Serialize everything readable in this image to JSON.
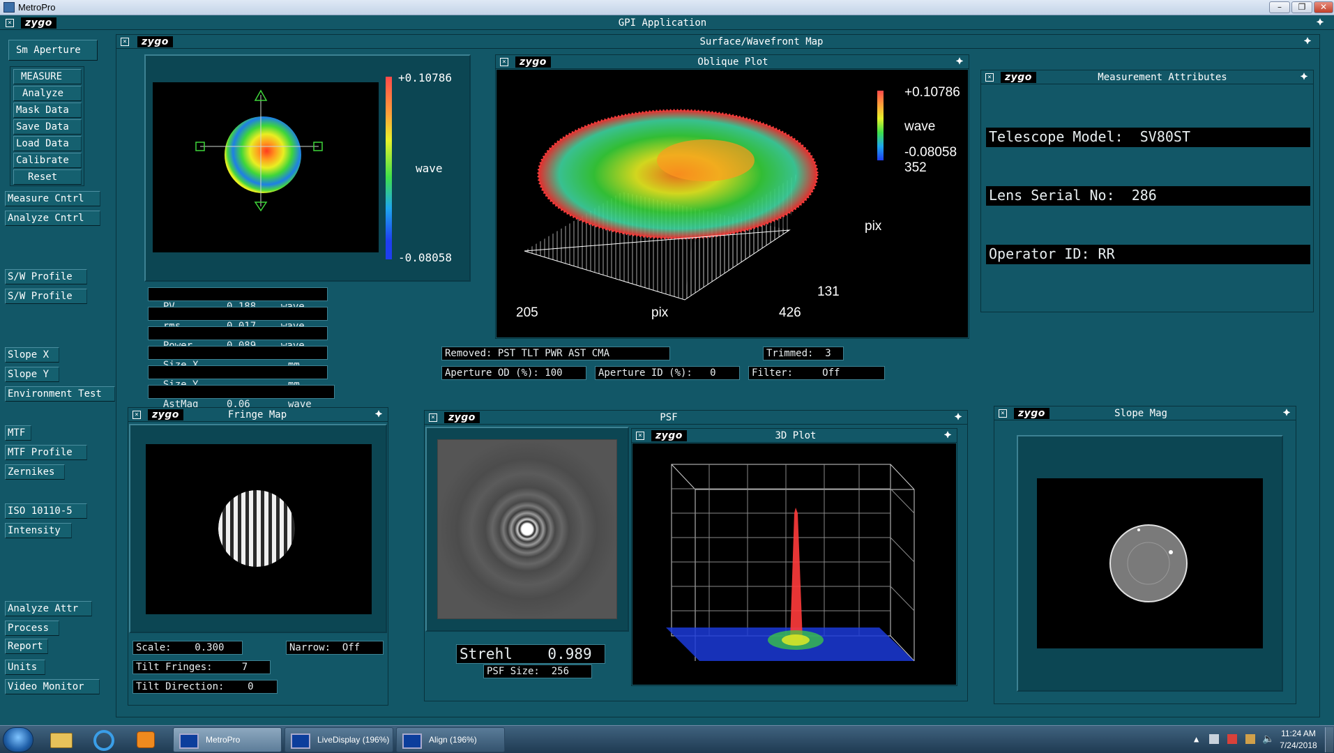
{
  "window": {
    "title": "MetroPro",
    "min": "–",
    "max": "❐",
    "close": "✕"
  },
  "app": {
    "logo": "zygo",
    "title": "GPI Application"
  },
  "left_buttons": {
    "sm_aperture": "Sm Aperture",
    "measure": "MEASURE",
    "analyze": "Analyze",
    "mask_data": "Mask Data",
    "save_data": "Save Data",
    "load_data": "Load Data",
    "calibrate": "Calibrate",
    "reset": "Reset",
    "measure_cntrl": "Measure Cntrl",
    "analyze_cntrl": "Analyze Cntrl",
    "sw_profile_1": "S/W Profile",
    "sw_profile_2": "S/W Profile",
    "slope_x": "Slope X",
    "slope_y": "Slope Y",
    "environment_test": "Environment Test",
    "mtf": "MTF",
    "mtf_profile": "MTF Profile",
    "zernikes": "Zernikes",
    "iso": "ISO 10110-5",
    "intensity": "Intensity",
    "analyze_attr": "Analyze Attr",
    "process": "Process",
    "report": "Report",
    "units": "Units",
    "video_monitor": "Video Monitor"
  },
  "surface": {
    "title": "Surface/Wavefront Map",
    "scale_max": "+0.10786",
    "scale_min": "-0.08058",
    "unit": "wave",
    "stats": [
      {
        "name": "PV",
        "value": "0.188",
        "unit": "wave"
      },
      {
        "name": "rms",
        "value": "0.017",
        "unit": "wave"
      },
      {
        "name": "Power",
        "value": "0.089",
        "unit": "wave"
      },
      {
        "name": "Size X",
        "value": "",
        "unit": "mm"
      },
      {
        "name": "Size Y",
        "value": "",
        "unit": "mm"
      },
      {
        "name": "AstMag",
        "value": "0.06",
        "unit": "wave"
      }
    ],
    "removed": "Removed: PST TLT PWR AST CMA",
    "trimmed": "Trimmed:  3",
    "aperture_od": "Aperture OD (%): 100",
    "aperture_id": "Aperture ID (%):   0",
    "filter": "Filter:     Off"
  },
  "oblique": {
    "title": "Oblique Plot",
    "max": "+0.10786",
    "unit": "wave",
    "min": "-0.08058",
    "y_top": "352",
    "y_bottom": "131",
    "x_left": "205",
    "x_right": "426",
    "axis_y": "pix",
    "axis_x": "pix"
  },
  "measurement": {
    "title": "Measurement Attributes",
    "telescope": "Telescope Model:  SV80ST",
    "lens": "Lens Serial No:  286",
    "operator": "Operator ID: RR"
  },
  "fringe": {
    "title": "Fringe Map",
    "scale": "Scale:    0.300",
    "narrow": "Narrow:  Off",
    "tilt_fringes": "Tilt Fringes:     7",
    "tilt_direction": "Tilt Direction:    0"
  },
  "psf": {
    "title": "PSF",
    "strehl": "Strehl    0.989",
    "psf_size": "PSF Size:  256",
    "plot_title": "3D Plot"
  },
  "slope": {
    "title": "Slope Mag"
  },
  "taskbar": {
    "metropro": "MetroPro",
    "livedisplay": "LiveDisplay  (196%)",
    "align": "Align  (196%)",
    "time": "11:24 AM",
    "date": "7/24/2018"
  },
  "colors": {
    "bg": "#125767",
    "panel": "#0c4653"
  }
}
